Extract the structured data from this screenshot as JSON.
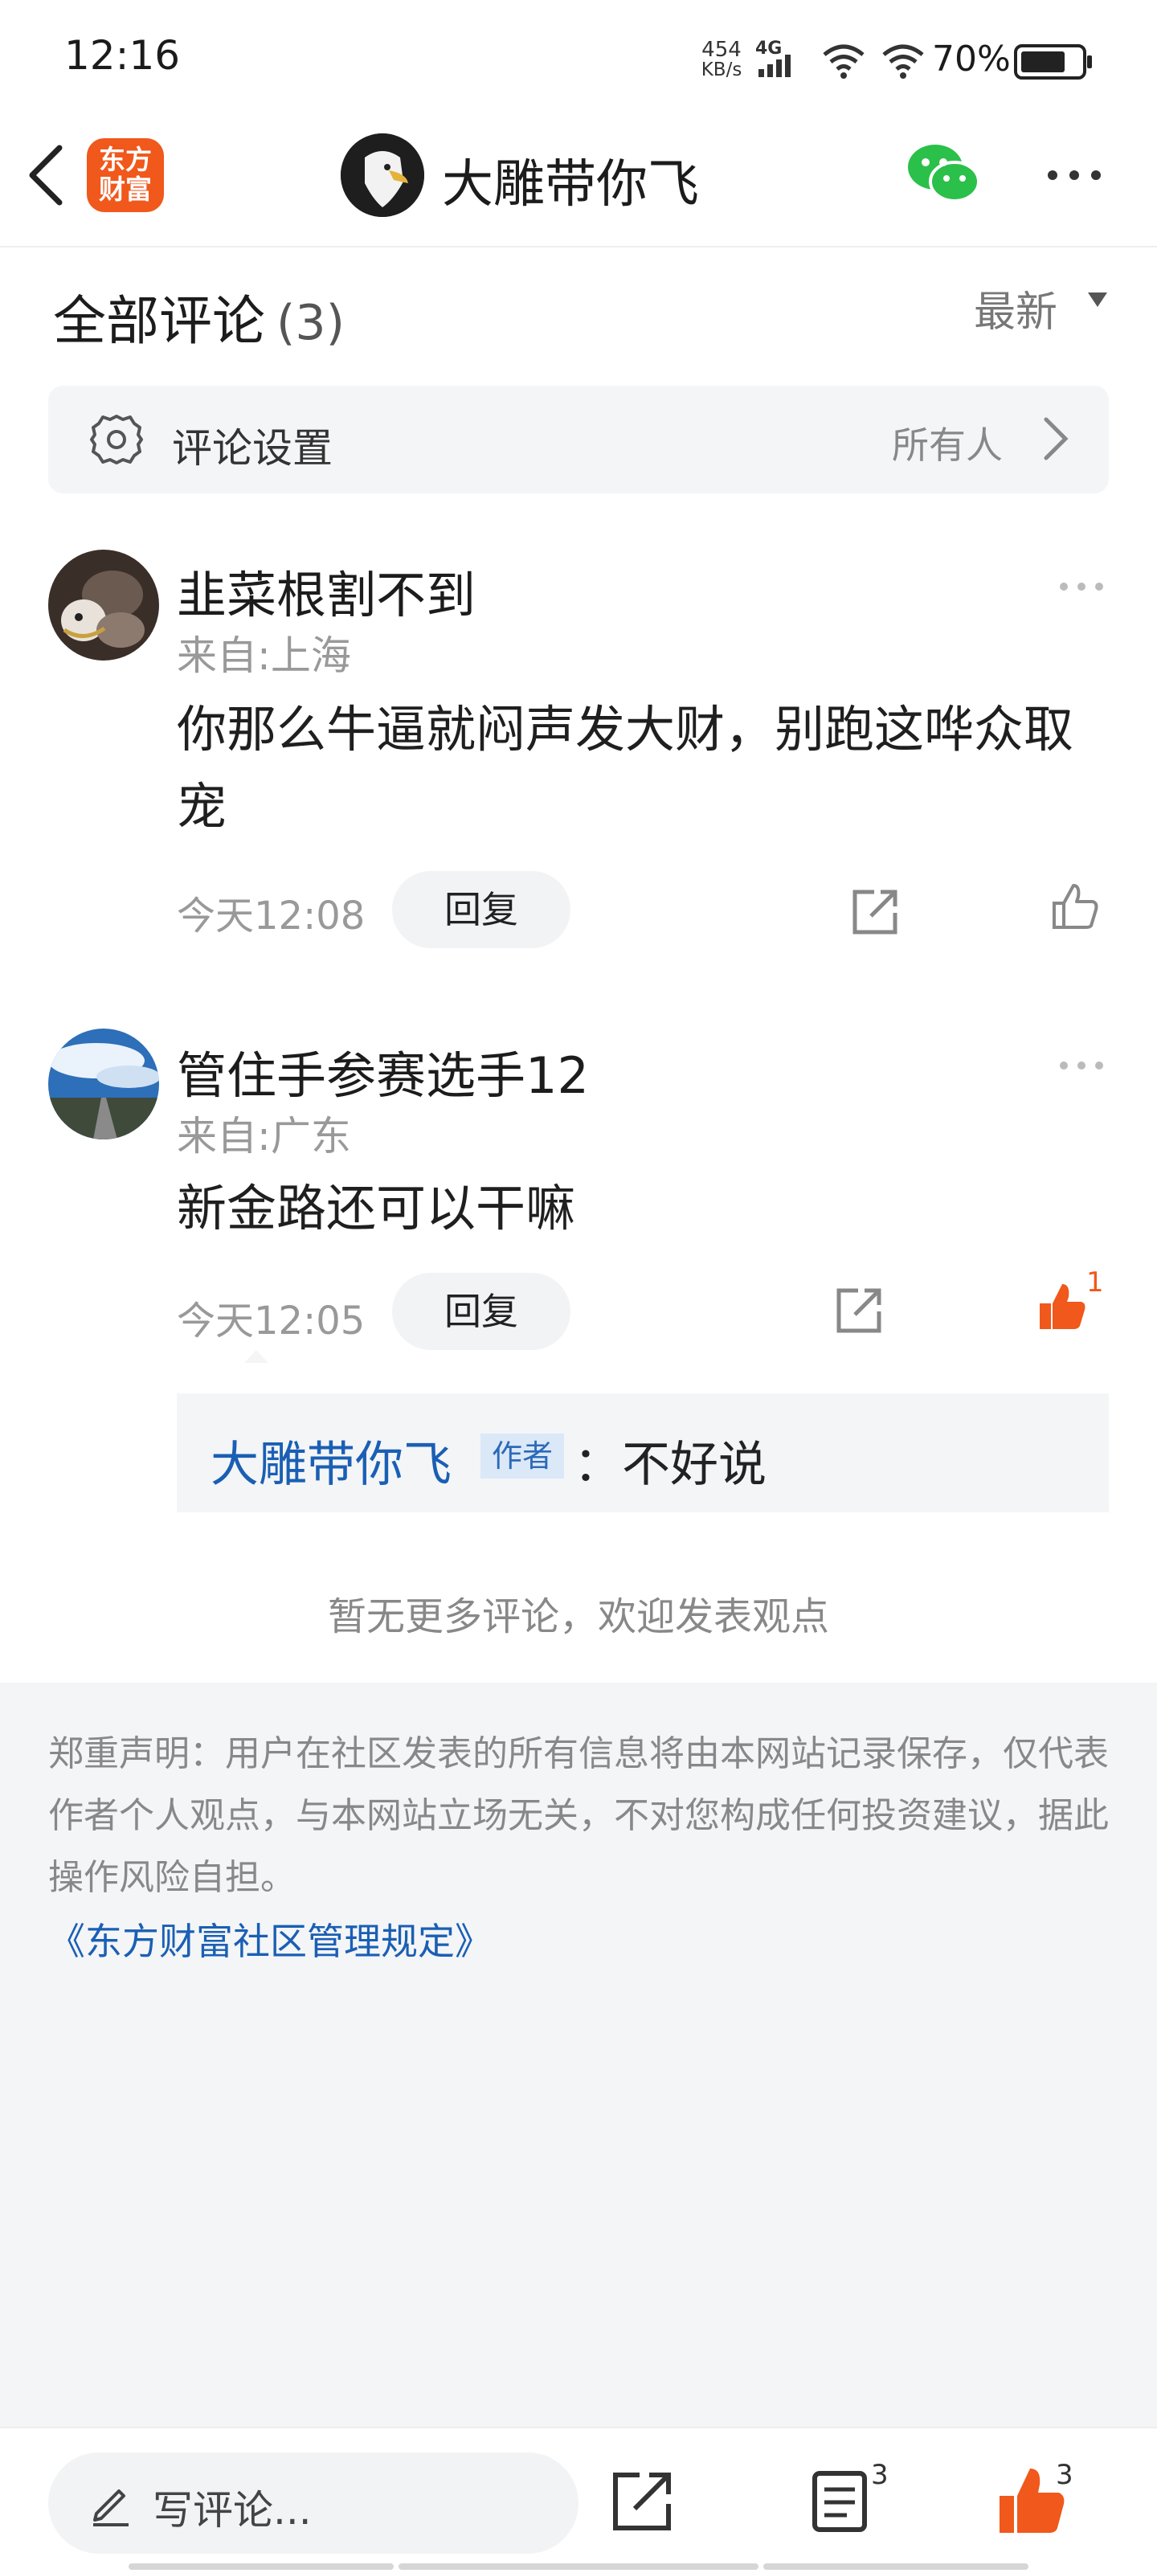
{
  "status_bar": {
    "time": "12:16",
    "net_speed_value": "454",
    "net_speed_unit": "KB/s",
    "network": "4G",
    "battery": "70%"
  },
  "header": {
    "logo_line1": "东方",
    "logo_line2": "财富",
    "title": "大雕带你飞"
  },
  "comments_section": {
    "heading": "全部评论",
    "count": "(3)",
    "sort": "最新",
    "settings_label": "评论设置",
    "settings_value": "所有人"
  },
  "comments": [
    {
      "username": "韭菜根割不到",
      "location": "来自:上海",
      "content": "你那么牛逼就闷声发大财，别跑这哗众取宠",
      "time": "今天12:08",
      "reply_label": "回复"
    },
    {
      "username": "管住手参赛选手12",
      "location": "来自:广东",
      "content": "新金路还可以干嘛",
      "time": "今天12:05",
      "reply_label": "回复",
      "likes": "1",
      "reply": {
        "author": "大雕带你飞",
        "badge": "作者",
        "text": "：不好说"
      }
    }
  ],
  "no_more": "暂无更多评论，欢迎发表观点",
  "footer": {
    "disclaimer": "郑重声明：用户在社区发表的所有信息将由本网站记录保存，仅代表作者个人观点，与本网站立场无关，不对您构成任何投资建议，据此操作风险自担。",
    "rules_link": "《东方财富社区管理规定》"
  },
  "bottom_bar": {
    "comment_placeholder": "写评论...",
    "comment_count": "3",
    "like_count": "3"
  },
  "colors": {
    "brand": "#f0581c",
    "link": "#1a5fb4",
    "liked": "#f0581c"
  }
}
